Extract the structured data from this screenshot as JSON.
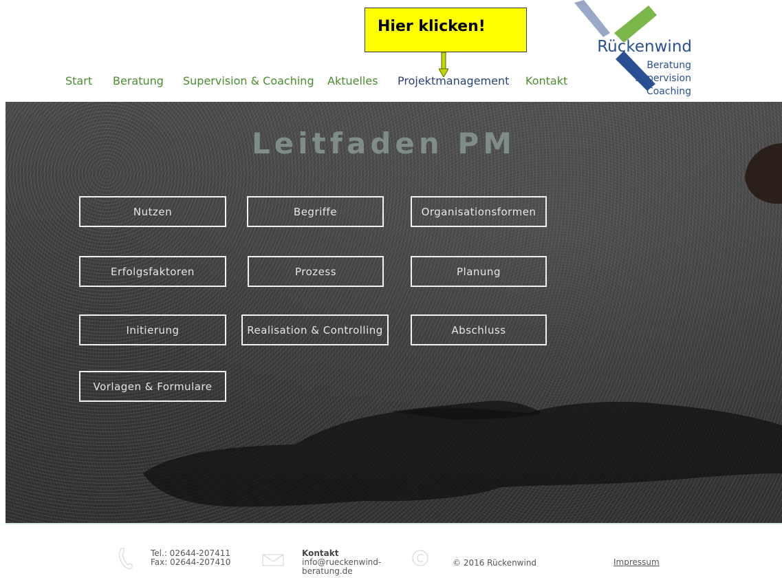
{
  "nav": {
    "items": [
      {
        "label": "Start",
        "active": false
      },
      {
        "label": "Beratung",
        "active": false
      },
      {
        "label": "Supervision & Coaching",
        "active": false
      },
      {
        "label": "Aktuelles",
        "active": false
      },
      {
        "label": "Projektmanagement",
        "active": true
      },
      {
        "label": "Kontakt",
        "active": false
      }
    ]
  },
  "callout": {
    "text": "Hier klicken!"
  },
  "logo": {
    "name": "Rückenwind",
    "line1": "Beratung",
    "line2": "Supervision",
    "line3": "Coaching"
  },
  "hero": {
    "title": "Leitfaden PM",
    "buttons": [
      "Nutzen",
      "Begriffe",
      "Organisationsformen",
      "Erfolgsfaktoren",
      "Prozess",
      "Planung",
      "Initierung",
      "Realisation & Controlling",
      "Abschluss",
      "Vorlagen & Formulare"
    ]
  },
  "footer": {
    "tel": "Tel.: 02644-207411",
    "fax": "Fax: 02644-207410",
    "kontakt_label": "Kontakt",
    "email_line1": "info@rueckenwind-",
    "email_line2": "beratung.de",
    "copyright": "© 2016 Rückenwind",
    "impressum": "Impressum"
  },
  "colors": {
    "nav_green": "#4a8c2e",
    "nav_active": "#2b3f7a",
    "callout_yellow": "#ffff00",
    "logo_blue": "#2b4f93",
    "logo_green": "#7ab648",
    "logo_lightblue": "#9aa8c8"
  }
}
